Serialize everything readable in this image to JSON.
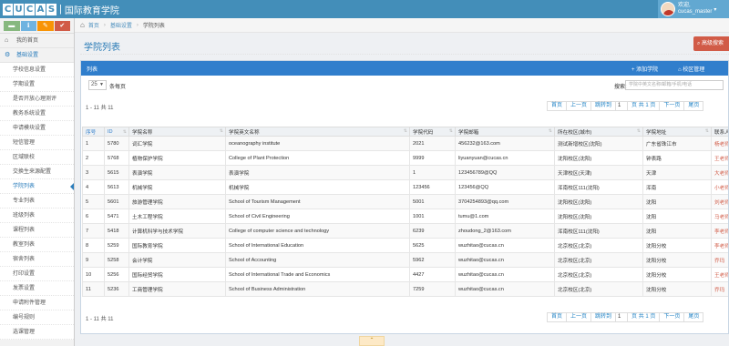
{
  "header": {
    "brand_letters": [
      "C",
      "U",
      "C",
      "A",
      "S"
    ],
    "brand_sep": "|",
    "title": "国际教育学院",
    "user_greeting": "欢迎,",
    "user_name": "cucas_master",
    "caret": "▾"
  },
  "sidebar": {
    "shortcuts": [
      {
        "glyph": "▬",
        "color": "#87b87f"
      },
      {
        "glyph": "ℹ",
        "color": "#6fb3e0"
      },
      {
        "glyph": "✎",
        "color": "#f89406"
      },
      {
        "glyph": "✔",
        "color": "#d15b47"
      }
    ],
    "home_label": "我的首页",
    "group_label": "基础设置",
    "items": [
      {
        "label": "学校信息设置"
      },
      {
        "label": "学期设置"
      },
      {
        "label": "是否开放心理测评"
      },
      {
        "label": "教务系统设置"
      },
      {
        "label": "申请模块设置"
      },
      {
        "label": "短信管理"
      },
      {
        "label": "区域联校"
      },
      {
        "label": "交换生来源配置"
      },
      {
        "label": "学院列表",
        "active": true
      },
      {
        "label": "专业列表"
      },
      {
        "label": "班级列表"
      },
      {
        "label": "课程列表"
      },
      {
        "label": "教室列表"
      },
      {
        "label": "宿舍列表"
      },
      {
        "label": "打印设置"
      },
      {
        "label": "发票设置"
      },
      {
        "label": "申请附件管理"
      },
      {
        "label": "编号规则"
      },
      {
        "label": "选课管理"
      }
    ]
  },
  "breadcrumb": {
    "home": "首页",
    "section": "基础设置",
    "current": "学院列表"
  },
  "page": {
    "title": "学院列表",
    "advanced_search": "高级搜索"
  },
  "panel": {
    "title": "列表",
    "add_button": "+ 添加学院",
    "campus_button": "⌂ 校区管理",
    "page_size": "25",
    "rows_label": "条每页",
    "search_label": "搜索:",
    "search_placeholder": "学院中英文名称/邮箱/手机/电话",
    "info_top": "1 - 11 共 11",
    "info_bottom": "1 - 11 共 11",
    "pager": {
      "first": "首页",
      "prev": "上一页",
      "jump": "跳转到",
      "page": "1",
      "of": "页 共 1 页",
      "next": "下一页",
      "last": "尾页"
    }
  },
  "table": {
    "columns": [
      "序号",
      "ID",
      "学院名称",
      "学院英文名称",
      "学院代码",
      "学院邮箱",
      "所在校区(城市)",
      "学院地址",
      "联系人"
    ],
    "rows": [
      [
        "1",
        "5780",
        "词汇学院",
        "oceanography institute",
        "2021",
        "456232@163.com",
        "测试新增校区(沈阳)",
        "广东省珠江市",
        "杨老师"
      ],
      [
        "2",
        "5768",
        "植物保护学院",
        "College of Plant Protection",
        "9999",
        "liyuanyuan@cucas.cn",
        "沈阳校区(沈阳)",
        "钟表路",
        "王老师"
      ],
      [
        "3",
        "5615",
        "表演学院",
        "表演学院",
        "1",
        "123456789@QQ",
        "天津校区(天津)",
        "天津",
        "大老师"
      ],
      [
        "4",
        "5613",
        "机械学院",
        "机械学院",
        "123456",
        "123456@QQ",
        "浑南校区111(沈阳)",
        "浑南",
        "小老师"
      ],
      [
        "5",
        "5601",
        "旅游管理学院",
        "School of Tourism Management",
        "5001",
        "3704254893@qq.com",
        "沈阳校区(沈阳)",
        "沈阳",
        "刘老师"
      ],
      [
        "6",
        "5471",
        "土木工程学院",
        "School of Civil Engineering",
        "1001",
        "tumu@1.com",
        "沈阳校区(沈阳)",
        "沈阳",
        "马老师"
      ],
      [
        "7",
        "5418",
        "计算机科学与技术学院",
        "College of computer science and technology",
        "6239",
        "zhoudong_2@163.com",
        "浑南校区111(沈阳)",
        "沈阳",
        "李老师"
      ],
      [
        "8",
        "5259",
        "国际教育学院",
        "School of International Education",
        "5625",
        "wuzhitao@cucas.cn",
        "北京校区(北京)",
        "沈阳分校",
        "李老师"
      ],
      [
        "9",
        "5258",
        "会计学院",
        "School of Accounting",
        "5962",
        "wuzhitao@cucas.cn",
        "北京校区(北京)",
        "沈阳分校",
        "乔玛"
      ],
      [
        "10",
        "5256",
        "国际经贸学院",
        "School of International Trade and Economics",
        "4427",
        "wuzhitao@cucas.cn",
        "北京校区(北京)",
        "沈阳分校",
        "王老师"
      ],
      [
        "11",
        "5236",
        "工商管理学院",
        "School of Business Administration",
        "7259",
        "wuzhitao@cucas.cn",
        "北京校区(北京)",
        "沈阳分校",
        "乔玛"
      ]
    ]
  },
  "footer": {
    "collapse": "⌃"
  },
  "colors": {
    "primary": "#307ecc",
    "topbar": "#438eb9",
    "danger": "#d15b47"
  }
}
